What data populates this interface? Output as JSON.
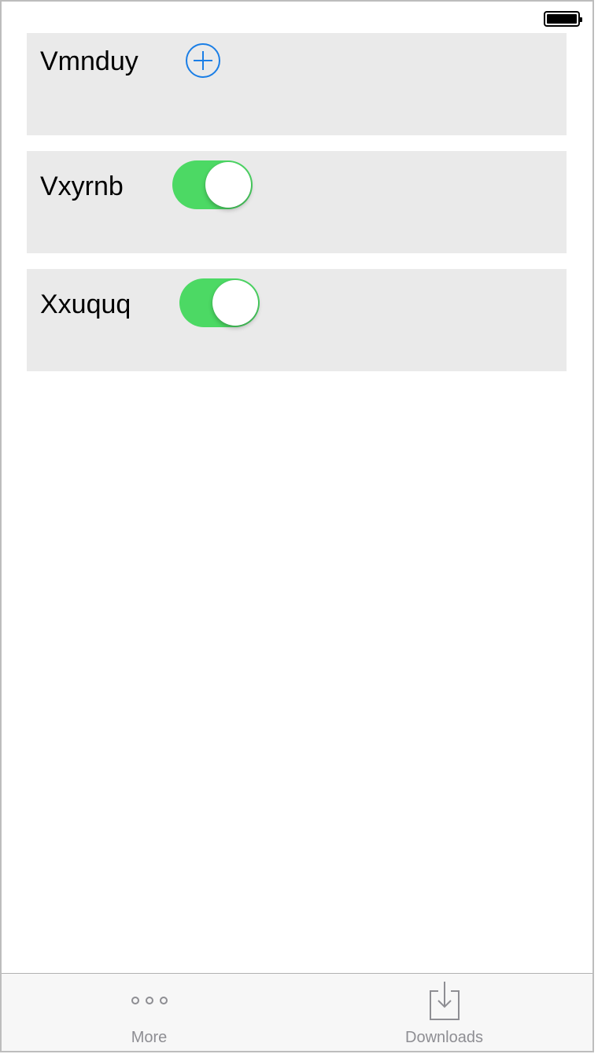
{
  "status_bar": {
    "battery_icon": "battery-full-icon",
    "battery_level": 1.0
  },
  "rows": [
    {
      "label": "Vmnduy",
      "control": "add-button",
      "icon": "plus-circle-icon"
    },
    {
      "label": "Vxyrnb",
      "control": "toggle",
      "on": true
    },
    {
      "label": "Xxuquq",
      "control": "toggle",
      "on": true
    }
  ],
  "tab_bar": {
    "tabs": [
      {
        "label": "More",
        "icon": "more-dots-icon"
      },
      {
        "label": "Downloads",
        "icon": "download-tray-icon"
      }
    ]
  },
  "colors": {
    "row_background": "#eaeaea",
    "toggle_on": "#4cd964",
    "accent_blue": "#1a7ee6",
    "tab_gray": "#8e8e93",
    "tab_bar_background": "#f7f7f7"
  }
}
